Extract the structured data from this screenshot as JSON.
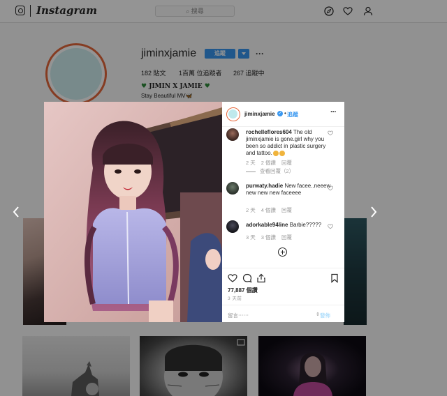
{
  "header": {
    "brand": "Instagram",
    "search_placeholder": "⌕ 搜尋",
    "icons": [
      "instagram-glyph-icon",
      "compass-icon",
      "heart-icon",
      "person-icon"
    ]
  },
  "profile": {
    "username": "jiminxjamie",
    "follow_label": "追蹤",
    "more_label": "···",
    "posts": "182 貼文",
    "followers": "1百萬 位追蹤者",
    "following": "267 追蹤中",
    "bio_name": "JIMIN X JAMIE",
    "bio_sub": "Stay Beautiful MV🦋"
  },
  "modal": {
    "post_user": "jiminxjamie",
    "dot": "•",
    "follow_label": "追蹤",
    "more_label": "···",
    "comments": [
      {
        "user": "rochelleflores604",
        "text": "The old jiminxjamie is gone.girl why you been so addict in plastic surgery and tattoo.",
        "time": "2 天",
        "likes": "2 個讚",
        "reply": "回覆",
        "view_replies": "查看回覆（2）"
      },
      {
        "user": "purwaty.hadie",
        "text": "New facee..neeew new new new faceeee",
        "time": "2 天",
        "likes": "4 個讚",
        "reply": "回覆"
      },
      {
        "user": "adorkable94line",
        "text": "Barbie?????",
        "time": "3 天",
        "likes": "3 個讚",
        "reply": "回覆"
      }
    ],
    "likes_count": "77,887 個讚",
    "posted_time": "3 天前",
    "add_comment_placeholder": "留言⋯⋯",
    "post_label": "發佈"
  },
  "colors": {
    "accent_blue": "#3897f0",
    "text": "#262626",
    "muted": "#999999",
    "bio_heart": "#2e8b3a"
  }
}
